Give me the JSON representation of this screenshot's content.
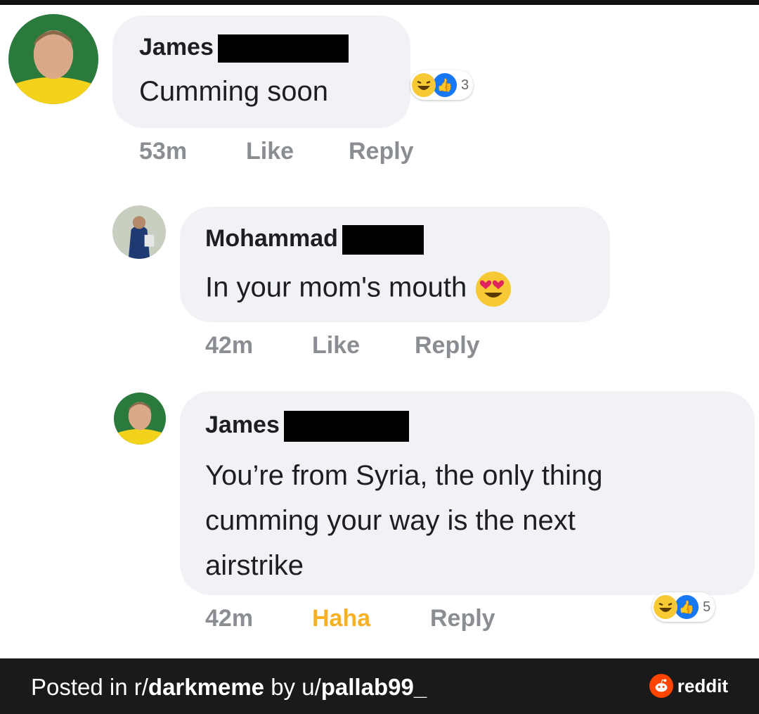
{
  "comments": [
    {
      "author": "James",
      "text_lines": [
        "Cumming soon"
      ],
      "time": "53m",
      "like_label": "Like",
      "reply_label": "Reply",
      "reaction_count": "3"
    },
    {
      "author": "Mohammad",
      "text_lines": [
        "In your mom's mouth"
      ],
      "time": "42m",
      "like_label": "Like",
      "reply_label": "Reply"
    },
    {
      "author": "James",
      "text_lines": [
        "You’re from Syria, the only thing",
        "cumming your way is the next",
        "airstrike"
      ],
      "time": "42m",
      "like_label": "Haha",
      "reply_label": "Reply",
      "reaction_count": "5"
    }
  ],
  "footer": {
    "posted_in": "Posted in r/",
    "subreddit": "darkmeme",
    "by": " by u/",
    "user": "pallab99_",
    "brand": "reddit"
  },
  "colors": {
    "bubble": "#f0f2f5",
    "meta": "#8a8d91",
    "haha": "#f7b125",
    "like_blue": "#1877f2",
    "footer_bg": "#1a1a1b",
    "reddit_orange": "#ff4500"
  },
  "icons": [
    "haha-emoji-icon",
    "like-thumb-icon",
    "heart-eyes-emoji-icon",
    "reddit-logo-icon"
  ]
}
